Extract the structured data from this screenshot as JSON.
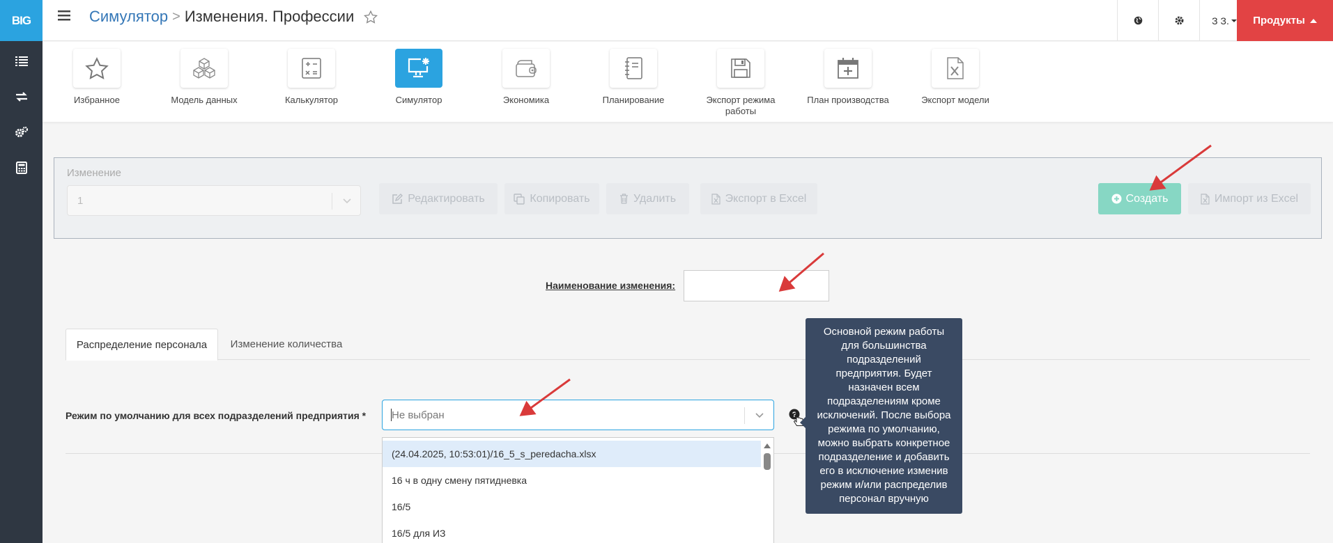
{
  "brand": {
    "logo": "BIG",
    "accent": "#2ba3e0",
    "products_color": "#e24344",
    "create_color": "#87d7c4"
  },
  "sidebar": {
    "items": [
      {
        "icon": "list-icon"
      },
      {
        "icon": "exchange-icon"
      },
      {
        "icon": "gears-icon"
      },
      {
        "icon": "calculator-icon"
      }
    ]
  },
  "header": {
    "breadcrumb_parent": "Симулятор",
    "breadcrumb_separator": ">",
    "title": "Изменения. Профессии",
    "user": "З З.",
    "products": "Продукты"
  },
  "modules": [
    {
      "label": "Избранное",
      "icon": "star-icon",
      "active": false
    },
    {
      "label": "Модель данных",
      "icon": "cubes-icon",
      "active": false
    },
    {
      "label": "Калькулятор",
      "icon": "calculator-icon",
      "active": false
    },
    {
      "label": "Симулятор",
      "icon": "monitor-gear-icon",
      "active": true
    },
    {
      "label": "Экономика",
      "icon": "wallet-icon",
      "active": false
    },
    {
      "label": "Планирование",
      "icon": "notebook-icon",
      "active": false
    },
    {
      "label": "Экспорт режима работы",
      "icon": "floppy-icon",
      "active": false
    },
    {
      "label": "План производства",
      "icon": "calendar-plus-icon",
      "active": false
    },
    {
      "label": "Экспорт модели",
      "icon": "excel-file-icon",
      "active": false
    }
  ],
  "change_panel": {
    "label": "Изменение",
    "selected": "1",
    "edit": "Редактировать",
    "copy": "Копировать",
    "delete": "Удалить",
    "export_excel": "Экспорт в Excel",
    "create": "Создать",
    "import_excel": "Импорт из Excel"
  },
  "name_field": {
    "label": "Наименование изменения:",
    "value": ""
  },
  "tabs": [
    {
      "label": "Распределение персонала",
      "active": true
    },
    {
      "label": "Изменение количества",
      "active": false
    }
  ],
  "mode": {
    "label": "Режим по умолчанию для всех подразделений предприятия *",
    "placeholder": "Не выбран",
    "options": [
      "(24.04.2025, 10:53:01)/16_5_s_peredacha.xlsx",
      "16 ч в одну смену пятидневка",
      "16/5",
      "16/5 для ИЗ"
    ],
    "highlighted_index": 0
  },
  "tooltip": {
    "text": "Основной режим работы для большинства подразделений предприятия. Будет назначен всем подразделениям кроме исключений. После выбора режима по умолчанию, можно выбрать конкретное подразделение и добавить его в исключение изменив режим и/или распределив персонал вручную"
  }
}
